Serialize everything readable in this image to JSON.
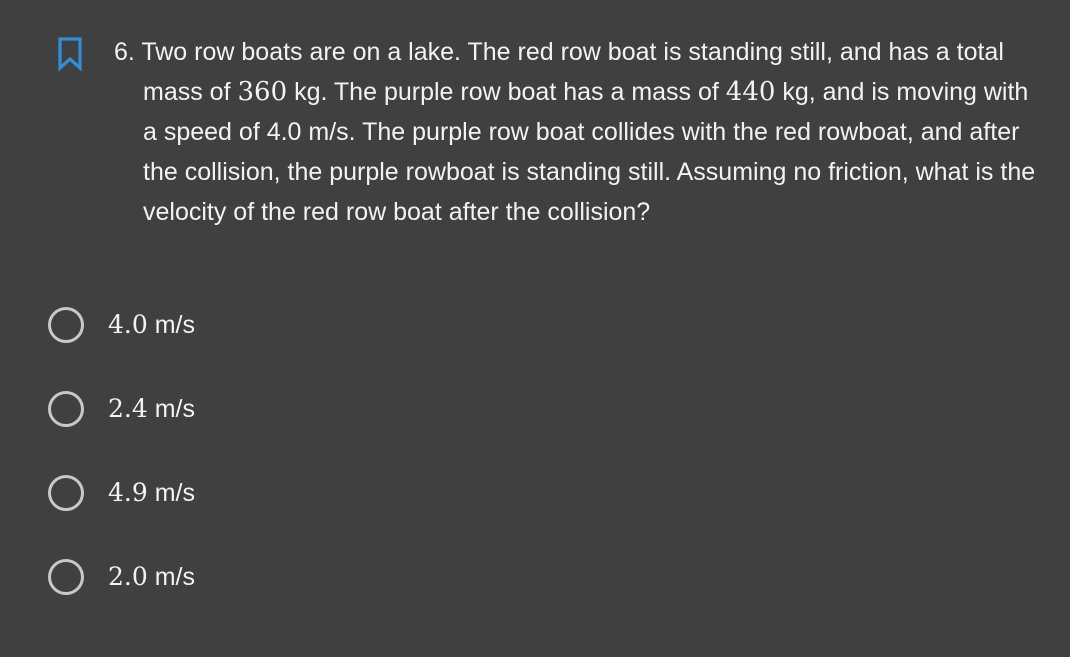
{
  "question": {
    "number": "6.",
    "text_1": "Two row boats are on a lake. The red row boat is standing still, and has a total mass of ",
    "mass_red": "360",
    "text_2": " kg. The purple row boat has a mass of ",
    "mass_purple": "440",
    "text_3": " kg, and is moving with a speed of 4.0 m/s. The purple row boat collides with the red rowboat, and after the collision, the purple rowboat is standing still. Assuming no friction, what is the velocity of the red row boat after the collision?",
    "bookmark_icon": "bookmark-outline-icon",
    "accent_color": "#2f8fd8"
  },
  "options": [
    {
      "value": "4.0",
      "unit": " m/s"
    },
    {
      "value": "2.4",
      "unit": " m/s"
    },
    {
      "value": "4.9",
      "unit": " m/s"
    },
    {
      "value": "2.0",
      "unit": " m/s"
    }
  ]
}
